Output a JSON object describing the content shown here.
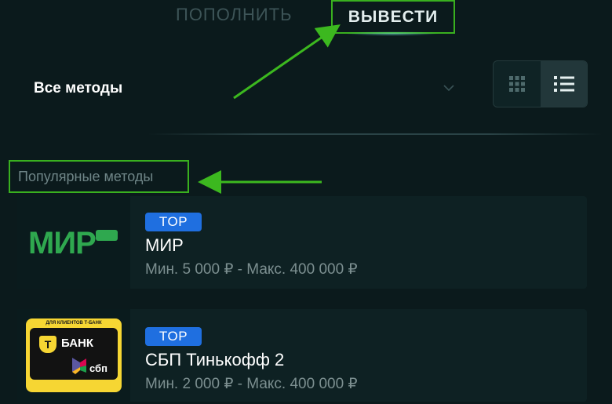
{
  "tabs": {
    "deposit": "ПОПОЛНИТЬ",
    "withdraw": "ВЫВЕСТИ"
  },
  "filter": {
    "label": "Все методы"
  },
  "view_toggle": {
    "icons": [
      "grid-icon",
      "list-icon"
    ],
    "active": "list"
  },
  "section": {
    "title": "Популярные методы"
  },
  "methods": [
    {
      "badge": "TOP",
      "name": "МИР",
      "limits": "Мин. 5 000 ₽ - Макс. 400 000 ₽",
      "logo_text": "МИР"
    },
    {
      "badge": "TOP",
      "name": "СБП Тинькофф 2",
      "limits": "Мин. 2 000 ₽ - Макс. 400 000 ₽",
      "logo_top": "ДЛЯ КЛИЕНТОВ Т-БАНК",
      "logo_bank": "БАНК",
      "logo_shield": "Т",
      "logo_sbp": "сбп"
    }
  ],
  "colors": {
    "background": "#0b1a1c",
    "highlight": "#39b01f",
    "badge": "#1f6fe0",
    "mir_green": "#2fa84f"
  }
}
